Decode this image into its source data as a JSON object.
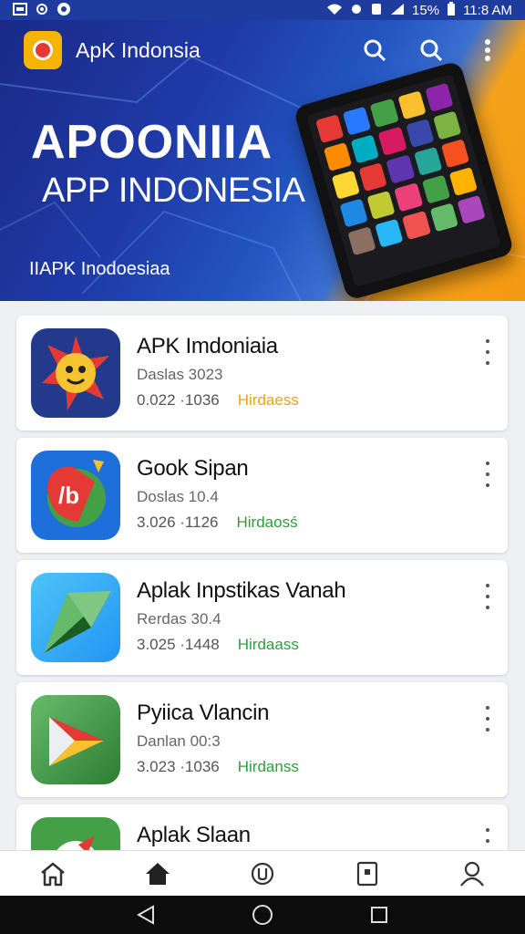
{
  "status_bar": {
    "battery": "15%",
    "time": "11:8 AM",
    "left_icons": [
      "image-icon",
      "settings-icon",
      "notification-icon"
    ],
    "right_icons": [
      "wifi-icon",
      "location-icon",
      "sim-icon",
      "signal-icon",
      "battery-icon"
    ]
  },
  "app_bar": {
    "title": "ApK Indonsia",
    "actions": [
      "search-icon",
      "search-icon",
      "more-vert-icon"
    ]
  },
  "banner": {
    "title": "APOONIIA",
    "subtitle": "APP INDONESIA",
    "caption": "IIAPK Inodoesiaa"
  },
  "apps": [
    {
      "name": "APK Imdoniaia",
      "sub": "Daslas 3023",
      "version": "0.022 ·1036",
      "status": "Hirdaess",
      "status_color": "#e8a21b"
    },
    {
      "name": "Gook Sipan",
      "sub": "Doslas 10.4",
      "version": "3.026 ·1126",
      "status": "Hirdaosś",
      "status_color": "#2e9e3a"
    },
    {
      "name": "Aplak Inpstikas Vanah",
      "sub": "Rerdas 30.4",
      "version": "3.025 ·1448",
      "status": "Hirdaass",
      "status_color": "#2e9e3a"
    },
    {
      "name": "Pyiica Vlancin",
      "sub": "Danlan 00:3",
      "version": "3.023 ·1036",
      "status": "Hirdanss",
      "status_color": "#2e9e3a"
    },
    {
      "name": "Aplak Slaan",
      "sub": "",
      "version": "",
      "status": "",
      "status_color": "#2e9e3a"
    }
  ],
  "bottom_nav": [
    "home-outline-icon",
    "home-filled-icon",
    "update-circle-icon",
    "tablet-icon",
    "profile-icon"
  ],
  "system_nav": [
    "back-icon",
    "home-circle-icon",
    "recents-icon"
  ],
  "colors": {
    "banner_blue": "#1f3aa8",
    "banner_orange": "#f59a12",
    "status_green": "#2e9e3a",
    "status_orange": "#e8a21b"
  }
}
